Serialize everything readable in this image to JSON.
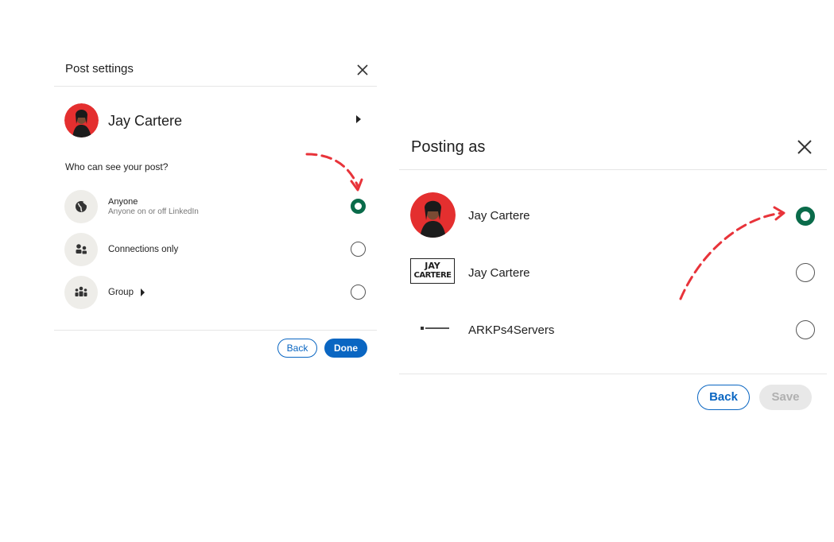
{
  "post_settings": {
    "title": "Post settings",
    "account_name": "Jay Cartere",
    "question": "Who can see your post?",
    "options": [
      {
        "label": "Anyone",
        "sublabel": "Anyone on or off LinkedIn",
        "icon": "globe-icon",
        "selected": true
      },
      {
        "label": "Connections only",
        "sublabel": "",
        "icon": "people-icon",
        "selected": false
      },
      {
        "label": "Group",
        "sublabel": "",
        "icon": "group-icon",
        "selected": false
      }
    ],
    "back_label": "Back",
    "done_label": "Done"
  },
  "posting_as": {
    "title": "Posting as",
    "accounts": [
      {
        "name": "Jay Cartere",
        "avatar": "profile-photo",
        "selected": true
      },
      {
        "name": "Jay Cartere",
        "avatar": "logo",
        "logo_line1": "JAY",
        "logo_line2": "CARTERE",
        "selected": false
      },
      {
        "name": "ARKPs4Servers",
        "avatar": "small-logo",
        "selected": false
      }
    ],
    "back_label": "Back",
    "save_label": "Save"
  },
  "colors": {
    "accent_blue": "#0a66c2",
    "selected_green": "#0a6b4a",
    "annotation_red": "#e8333a",
    "disabled_gray": "#e8e8e8"
  }
}
